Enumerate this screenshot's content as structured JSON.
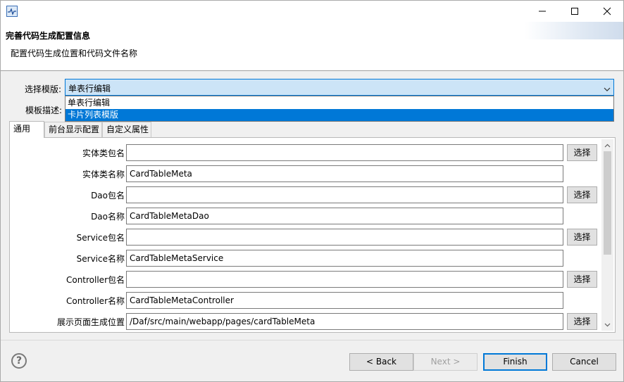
{
  "window": {
    "minimize_icon": "minimize-icon",
    "maximize_icon": "maximize-icon",
    "close_icon": "close-icon"
  },
  "header": {
    "title": "完善代码生成配置信息",
    "description": "配置代码生成位置和代码文件名称"
  },
  "template": {
    "label": "选择模版:",
    "selected": "单表行编辑",
    "options": [
      "单表行编辑",
      "卡片列表模版"
    ],
    "highlighted_option": "卡片列表模版",
    "desc_label": "模板描述:"
  },
  "tabs": [
    {
      "label": "通用",
      "active": true
    },
    {
      "label": "前台显示配置",
      "active": false
    },
    {
      "label": "自定义属性",
      "active": false
    }
  ],
  "form": {
    "browse_label": "选择",
    "rows": [
      {
        "label": "实体类包名",
        "value": "",
        "browse": true
      },
      {
        "label": "实体类名称",
        "value": "CardTableMeta",
        "browse": false
      },
      {
        "label": "Dao包名",
        "value": "",
        "browse": true
      },
      {
        "label": "Dao名称",
        "value": "CardTableMetaDao",
        "browse": false
      },
      {
        "label": "Service包名",
        "value": "",
        "browse": true
      },
      {
        "label": "Service名称",
        "value": "CardTableMetaService",
        "browse": false
      },
      {
        "label": "Controller包名",
        "value": "",
        "browse": true
      },
      {
        "label": "Controller名称",
        "value": "CardTableMetaController",
        "browse": false
      },
      {
        "label": "展示页面生成位置",
        "value": "/Daf/src/main/webapp/pages/cardTableMeta",
        "browse": true
      }
    ]
  },
  "footer": {
    "help": "?",
    "back": "< Back",
    "next": "Next >",
    "finish": "Finish",
    "cancel": "Cancel"
  },
  "colors": {
    "accent": "#0078d7",
    "combo_bg": "#cce4f7"
  }
}
